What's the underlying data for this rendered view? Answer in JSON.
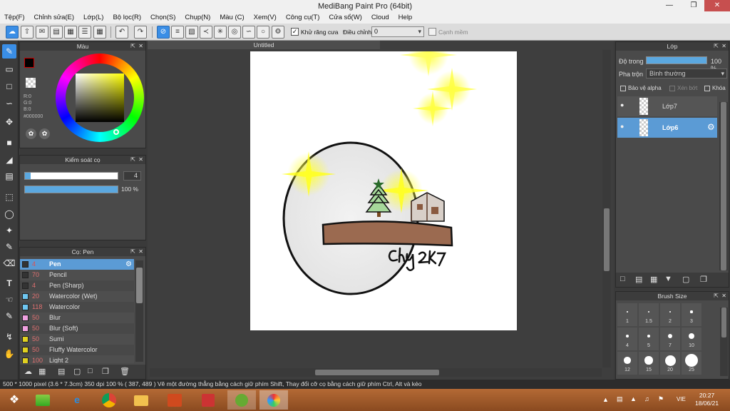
{
  "window": {
    "title": "MediBang Paint Pro (64bit)"
  },
  "menu": [
    "Tệp(F)",
    "Chỉnh sửa(E)",
    "Lớp(L)",
    "Bộ lọc(R)",
    "Chọn(S)",
    "Chụp(N)",
    "Màu (C)",
    "Xem(V)",
    "Công cụ(T)",
    "Cửa sổ(W)",
    "Cloud",
    "Help"
  ],
  "toolbar": {
    "antialias_label": "Khử răng cưa",
    "correction_label": "Điều chỉnh",
    "correction_value": "0",
    "canvas_edge_label": "Cạnh mềm"
  },
  "color_panel": {
    "title": "Màu",
    "rgb": {
      "r": "R:0",
      "g": "G:0",
      "b": "B:0"
    },
    "hex": "#000000"
  },
  "brush_control": {
    "title": "Kiểm soát cọ",
    "size": "4",
    "opacity": "100 %",
    "opacity_fraction": 1.0,
    "size_fraction": 0.04
  },
  "brush_panel": {
    "title": "Cọ: Pen",
    "items": [
      {
        "size": "4",
        "name": "Pen",
        "color": "#333333",
        "selected": true
      },
      {
        "size": "70",
        "name": "Pencil",
        "color": "#333333"
      },
      {
        "size": "4",
        "name": "Pen (Sharp)",
        "color": "#333333"
      },
      {
        "size": "20",
        "name": "Watercolor (Wet)",
        "color": "#6ec6f0"
      },
      {
        "size": "118",
        "name": "Watercolor",
        "color": "#6ec6f0"
      },
      {
        "size": "50",
        "name": "Blur",
        "color": "#f0a0e0"
      },
      {
        "size": "50",
        "name": "Blur (Soft)",
        "color": "#f0a0e0"
      },
      {
        "size": "50",
        "name": "Sumi",
        "color": "#e0d020"
      },
      {
        "size": "50",
        "name": "Fluffy Watercolor",
        "color": "#e0d020"
      },
      {
        "size": "100",
        "name": "Light 2",
        "color": "#e0d020"
      }
    ]
  },
  "document": {
    "tab": "Untitled",
    "signature": "Chuy 2K7"
  },
  "layer_panel": {
    "title": "Lớp",
    "opacity_label": "Độ trong",
    "opacity_value": "100 %",
    "blend_label": "Pha trộn",
    "blend_value": "Bình thường",
    "protect_alpha": "Bảo vệ alpha",
    "clipping": "Xén bớt",
    "lock": "Khóa",
    "layers": [
      {
        "name": "Lớp7",
        "selected": false
      },
      {
        "name": "Lớp6",
        "selected": true
      }
    ]
  },
  "brush_size_panel": {
    "title": "Brush Size",
    "sizes": [
      "1",
      "1.5",
      "2",
      "3",
      "4",
      "5",
      "7",
      "10",
      "12",
      "15",
      "20",
      "25"
    ]
  },
  "status": {
    "text": "500 * 1000 pixel   (3.6 * 7.3cm)   350 dpi   100 %   ( 387, 489 )   Vẽ một đường thẳng bằng cách giữ phím Shift, Thay đổi cỡ cọ bằng cách giữ phím Ctrl, Alt và kéo"
  },
  "taskbar": {
    "lang": "VIE",
    "time": "20:27",
    "date": "18/06/21"
  },
  "colors": {
    "accent": "#3a8ee6",
    "panel": "#4a4a4a",
    "selected_row": "#5b9bd5"
  }
}
